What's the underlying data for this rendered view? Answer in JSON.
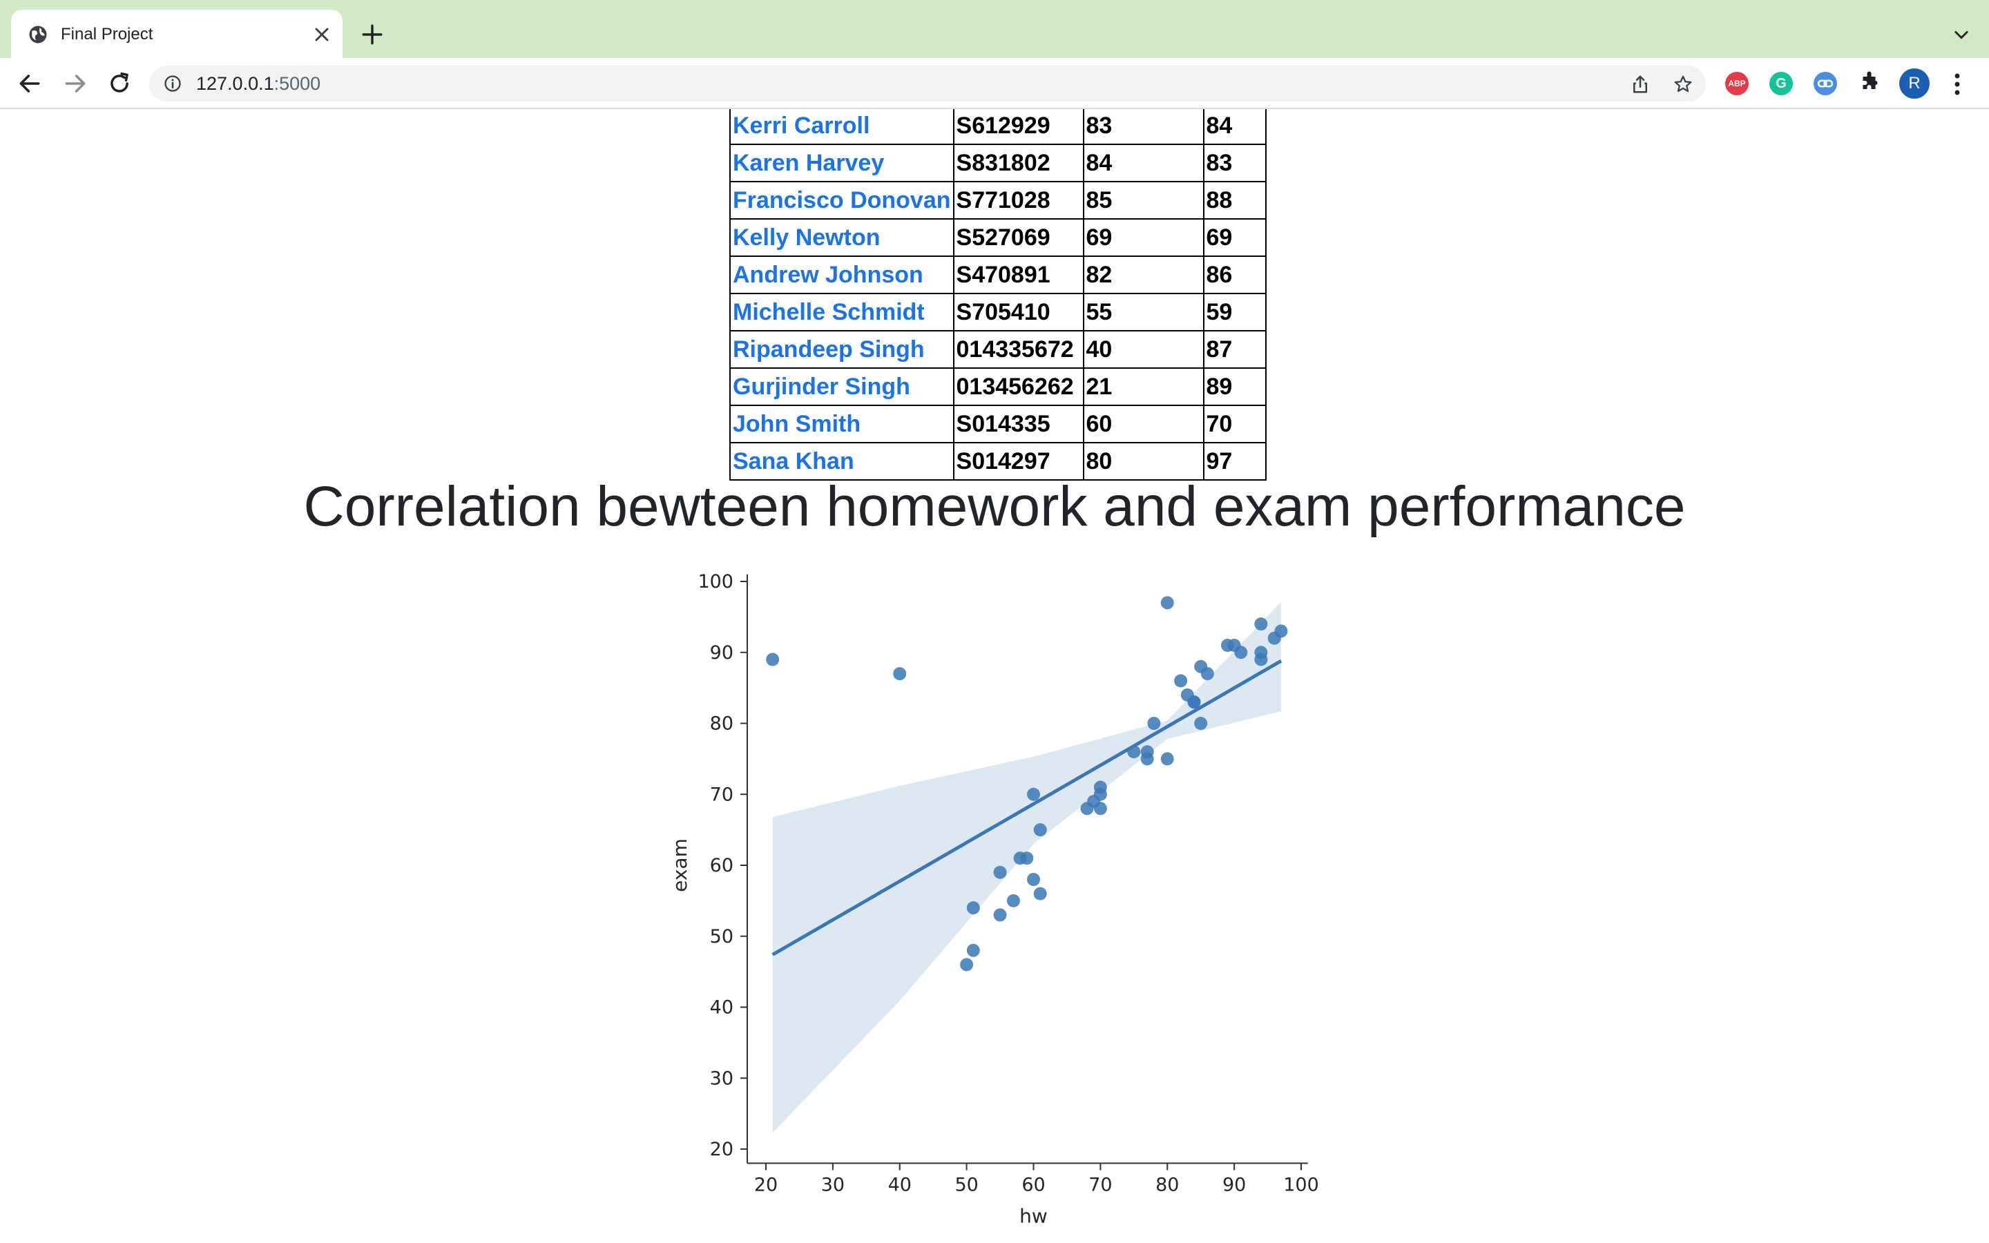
{
  "browser": {
    "tab_title": "Final Project",
    "url_host": "127.0.0.1",
    "url_port": ":5000",
    "extensions": {
      "abp_label": "ABP",
      "grammarly_label": "G"
    },
    "profile_initial": "R"
  },
  "table": {
    "rows": [
      {
        "name": "Kerri Carroll",
        "id": "S612929",
        "hw": "83",
        "exam": "84"
      },
      {
        "name": "Karen Harvey",
        "id": "S831802",
        "hw": "84",
        "exam": "83"
      },
      {
        "name": "Francisco Donovan",
        "id": "S771028",
        "hw": "85",
        "exam": "88"
      },
      {
        "name": "Kelly Newton",
        "id": "S527069",
        "hw": "69",
        "exam": "69"
      },
      {
        "name": "Andrew Johnson",
        "id": "S470891",
        "hw": "82",
        "exam": "86"
      },
      {
        "name": "Michelle Schmidt",
        "id": "S705410",
        "hw": "55",
        "exam": "59"
      },
      {
        "name": "Ripandeep Singh",
        "id": "014335672",
        "hw": "40",
        "exam": "87"
      },
      {
        "name": "Gurjinder Singh",
        "id": "013456262",
        "hw": "21",
        "exam": "89"
      },
      {
        "name": "John Smith",
        "id": "S014335",
        "hw": "60",
        "exam": "70"
      },
      {
        "name": "Sana Khan",
        "id": "S014297",
        "hw": "80",
        "exam": "97"
      }
    ]
  },
  "heading": "Correlation bewteen homework and exam performance",
  "chart_data": {
    "type": "scatter",
    "title": "",
    "xlabel": "hw",
    "ylabel": "exam",
    "xlim": [
      18,
      101
    ],
    "ylim": [
      18,
      101
    ],
    "xticks": [
      20,
      30,
      40,
      50,
      60,
      70,
      80,
      90,
      100
    ],
    "yticks": [
      20,
      30,
      40,
      50,
      60,
      70,
      80,
      90,
      100
    ],
    "grid": false,
    "point_color": "#3a78b5",
    "line_color": "#3a78b5",
    "band_color": "#dde8f3",
    "points": [
      [
        21,
        89
      ],
      [
        40,
        87
      ],
      [
        80,
        97
      ],
      [
        94,
        94
      ],
      [
        97,
        93
      ],
      [
        96,
        92
      ],
      [
        89,
        91
      ],
      [
        90,
        91
      ],
      [
        91,
        90
      ],
      [
        94,
        90
      ],
      [
        94,
        89
      ],
      [
        85,
        88
      ],
      [
        86,
        87
      ],
      [
        82,
        86
      ],
      [
        83,
        84
      ],
      [
        84,
        83
      ],
      [
        84,
        83
      ],
      [
        78,
        80
      ],
      [
        85,
        80
      ],
      [
        75,
        76
      ],
      [
        77,
        76
      ],
      [
        77,
        75
      ],
      [
        80,
        75
      ],
      [
        70,
        71
      ],
      [
        60,
        70
      ],
      [
        70,
        70
      ],
      [
        69,
        69
      ],
      [
        68,
        68
      ],
      [
        70,
        68
      ],
      [
        61,
        65
      ],
      [
        55,
        59
      ],
      [
        58,
        61
      ],
      [
        59,
        61
      ],
      [
        60,
        58
      ],
      [
        61,
        56
      ],
      [
        57,
        55
      ],
      [
        51,
        54
      ],
      [
        55,
        53
      ],
      [
        51,
        48
      ],
      [
        50,
        46
      ]
    ],
    "regression": {
      "x": [
        21,
        97
      ],
      "y": [
        47.4,
        88.8
      ]
    },
    "confidence_band": {
      "x": [
        21,
        40,
        60,
        80,
        97
      ],
      "upper": [
        66.8,
        71.2,
        75.3,
        80.4,
        97.1
      ],
      "lower": [
        22.3,
        40.9,
        63.0,
        77.8,
        81.7
      ]
    }
  }
}
